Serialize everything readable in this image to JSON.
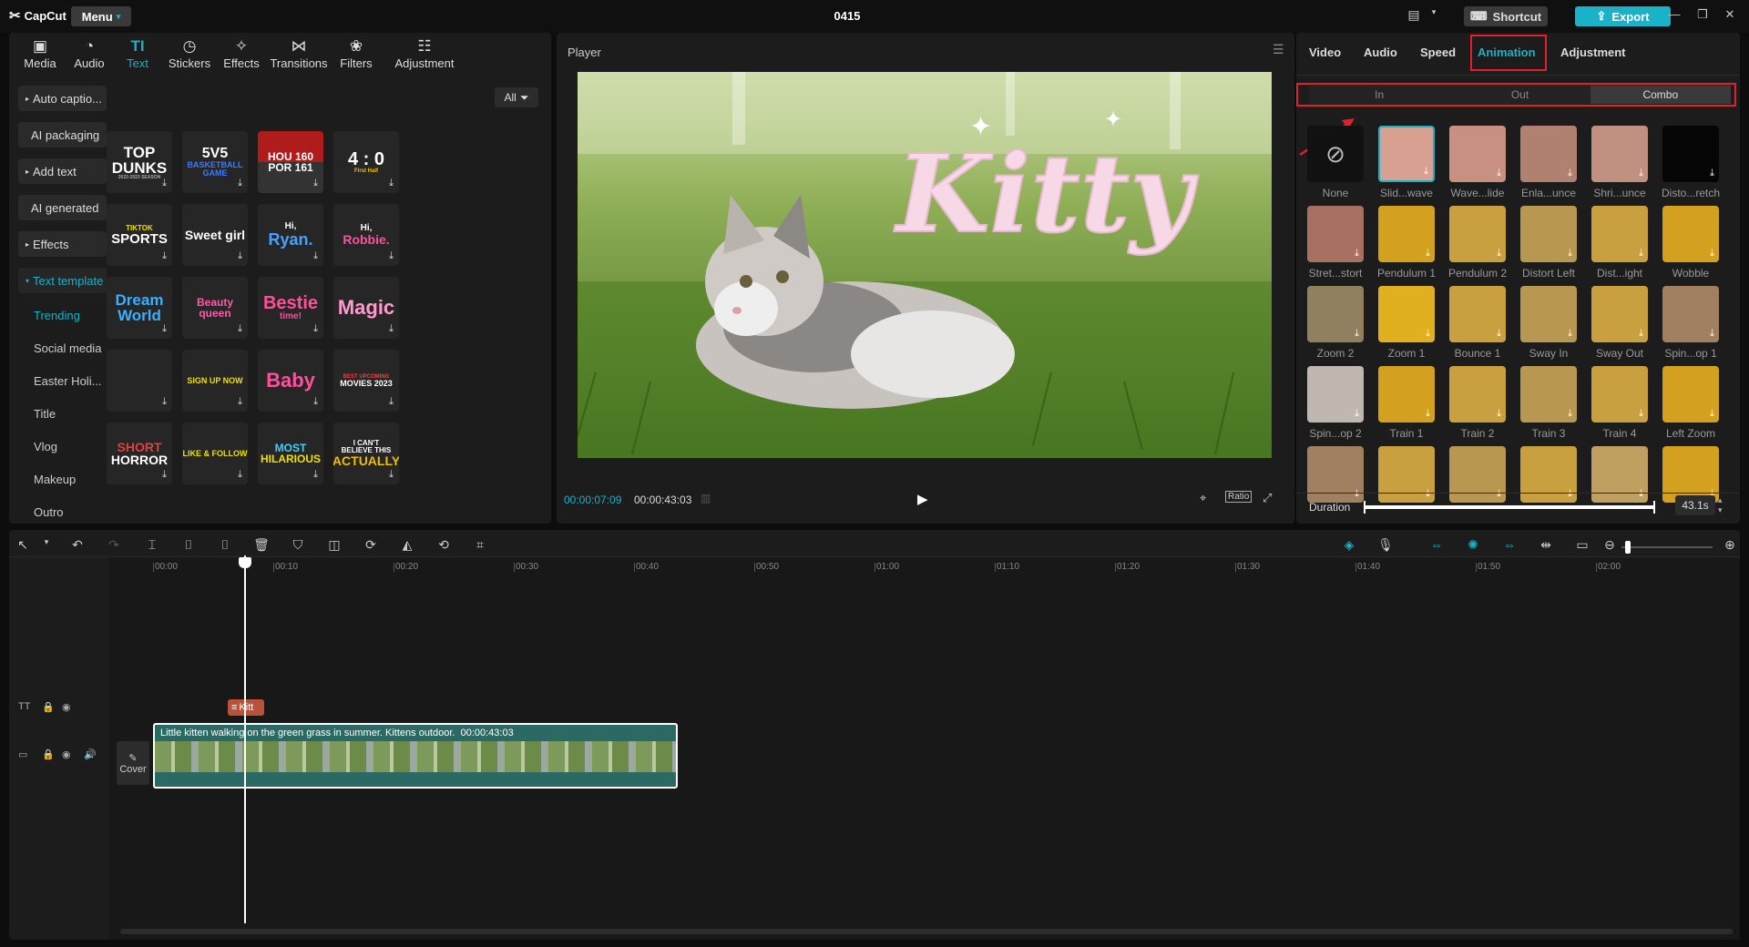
{
  "app": {
    "logo": "CapCut",
    "menu": "Menu",
    "project_title": "0415",
    "shortcut": "Shortcut",
    "export": "Export"
  },
  "media_tabs": [
    {
      "label": "Media",
      "icon": "media-icon"
    },
    {
      "label": "Audio",
      "icon": "audio-icon"
    },
    {
      "label": "Text",
      "icon": "text-icon",
      "active": true
    },
    {
      "label": "Stickers",
      "icon": "stickers-icon"
    },
    {
      "label": "Effects",
      "icon": "effects-icon"
    },
    {
      "label": "Transitions",
      "icon": "transitions-icon"
    },
    {
      "label": "Filters",
      "icon": "filters-icon"
    },
    {
      "label": "Adjustment",
      "icon": "adjustment-icon"
    }
  ],
  "left_nav": {
    "items": [
      "Auto captio...",
      "AI packaging",
      "Add text",
      "AI generated",
      "Effects",
      "Text template"
    ],
    "sub_items": [
      "Trending",
      "Social media",
      "Easter Holi...",
      "Title",
      "Vlog",
      "Makeup",
      "Outro"
    ],
    "filter_label": "All"
  },
  "templates": [
    {
      "lines": [
        "TOP",
        "DUNKS",
        "2022-2023 SEASON"
      ]
    },
    {
      "lines": [
        "5V5",
        "BASKETBALL",
        "GAME"
      ]
    },
    {
      "lines": [
        "HOU 160",
        "POR 161"
      ]
    },
    {
      "lines": [
        "4 : 0",
        "First Half"
      ]
    },
    {
      "lines": [
        "TIKTOK",
        "SPORTS"
      ]
    },
    {
      "lines": [
        "Sweet girl"
      ]
    },
    {
      "lines": [
        "Hi,",
        "Ryan."
      ]
    },
    {
      "lines": [
        "Hi,",
        "Robbie."
      ]
    },
    {
      "lines": [
        "Dream",
        "World"
      ]
    },
    {
      "lines": [
        "Beauty queen"
      ]
    },
    {
      "lines": [
        "Bestie",
        "time!"
      ]
    },
    {
      "lines": [
        "Magic"
      ]
    },
    {
      "lines": [
        ""
      ]
    },
    {
      "lines": [
        "SIGN UP NOW"
      ]
    },
    {
      "lines": [
        "Baby"
      ]
    },
    {
      "lines": [
        "BEST UPCOMING",
        "MOVIES 2023"
      ]
    },
    {
      "lines": [
        "SHORT",
        "HORROR"
      ]
    },
    {
      "lines": [
        "LIKE & FOLLOW"
      ]
    },
    {
      "lines": [
        "MOST",
        "HILARIOUS"
      ]
    },
    {
      "lines": [
        "I CAN'T",
        "BELIEVE THIS",
        "ACTUALLY"
      ]
    }
  ],
  "player": {
    "label": "Player",
    "overlay_text": "Kitty",
    "current_time": "00:00:07:09",
    "total_time": "00:00:43:03",
    "ratio": "Ratio"
  },
  "right_panel": {
    "tabs": [
      "Video",
      "Audio",
      "Speed",
      "Animation",
      "Adjustment"
    ],
    "active_tab": "Animation",
    "segments": [
      "In",
      "Out",
      "Combo"
    ],
    "active_segment": "Combo",
    "animations": [
      "None",
      "Slid...wave",
      "Wave...lide",
      "Enla...unce",
      "Shri...unce",
      "Disto...retch",
      "Stret...stort",
      "Pendulum 1",
      "Pendulum 2",
      "Distort Left",
      "Dist...ight",
      "Wobble",
      "Zoom 2",
      "Zoom 1",
      "Bounce 1",
      "Sway In",
      "Sway Out",
      "Spin...op 1",
      "Spin...op 2",
      "Train 1",
      "Train 2",
      "Train 3",
      "Train 4",
      "Left Zoom",
      "",
      "",
      "",
      "",
      "",
      ""
    ],
    "duration_label": "Duration",
    "duration_value": "43.1s"
  },
  "timeline": {
    "ruler": [
      "00:00",
      "00:10",
      "00:20",
      "00:30",
      "00:40",
      "00:50",
      "01:00",
      "01:10",
      "01:20",
      "01:30",
      "01:40",
      "01:50",
      "02:00"
    ],
    "text_clip": "Kitt",
    "video_clip_title": "Little kitten walking on the green grass in summer. Kittens outdoor.",
    "video_clip_duration": "00:00:43:03",
    "cover_label": "Cover"
  },
  "colors": {
    "accent": "#19b2c8",
    "highlight": "#e0202a",
    "panel": "#1c1c1c"
  }
}
